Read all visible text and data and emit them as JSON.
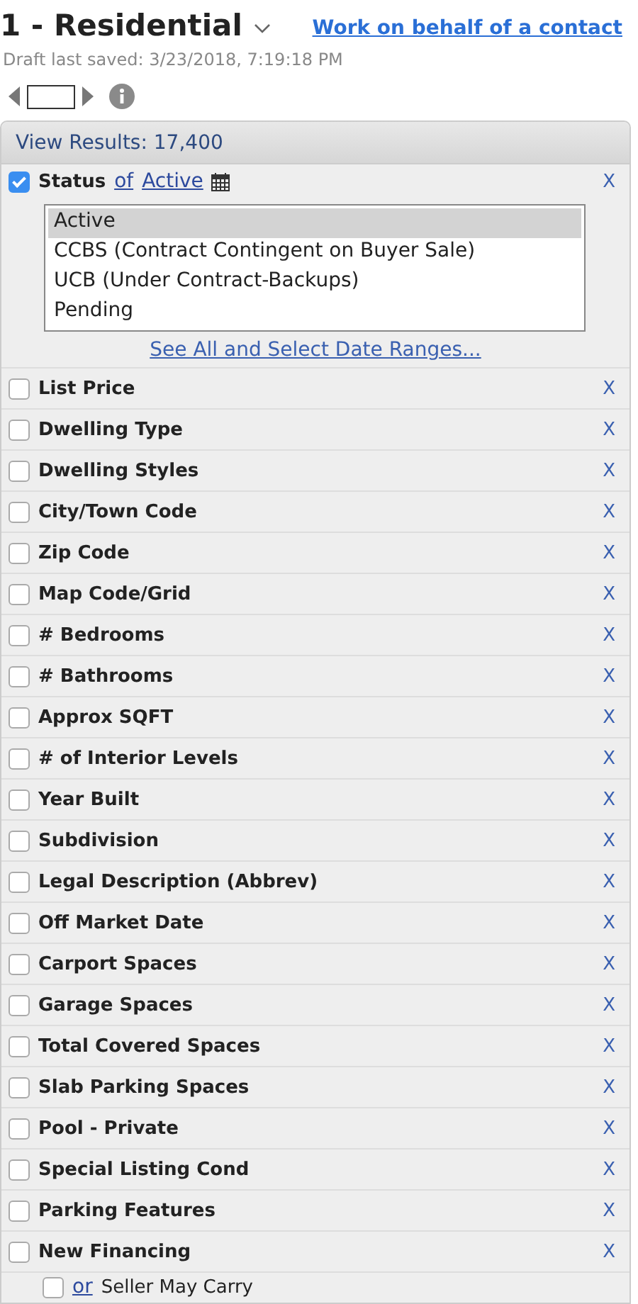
{
  "header": {
    "title": "1 - Residential",
    "link": "Work on behalf of a contact",
    "draft": "Draft last saved: 3/23/2018, 7:19:18 PM"
  },
  "panel": {
    "results": "View Results: 17,400"
  },
  "status": {
    "checked": true,
    "label": "Status",
    "connector": "of",
    "value": "Active",
    "remove": "X",
    "options": [
      {
        "label": "Active",
        "selected": true
      },
      {
        "label": "CCBS (Contract Contingent on Buyer Sale)",
        "selected": false
      },
      {
        "label": "UCB (Under Contract-Backups)",
        "selected": false
      },
      {
        "label": "Pending",
        "selected": false
      }
    ],
    "more_link": "See All and Select Date Ranges..."
  },
  "filters": [
    {
      "label": "List Price",
      "checked": false,
      "remove": "X"
    },
    {
      "label": "Dwelling Type",
      "checked": false,
      "remove": "X"
    },
    {
      "label": "Dwelling Styles",
      "checked": false,
      "remove": "X"
    },
    {
      "label": "City/Town Code",
      "checked": false,
      "remove": "X"
    },
    {
      "label": "Zip Code",
      "checked": false,
      "remove": "X"
    },
    {
      "label": "Map Code/Grid",
      "checked": false,
      "remove": "X"
    },
    {
      "label": "# Bedrooms",
      "checked": false,
      "remove": "X"
    },
    {
      "label": "# Bathrooms",
      "checked": false,
      "remove": "X"
    },
    {
      "label": "Approx SQFT",
      "checked": false,
      "remove": "X"
    },
    {
      "label": "# of Interior Levels",
      "checked": false,
      "remove": "X"
    },
    {
      "label": "Year Built",
      "checked": false,
      "remove": "X"
    },
    {
      "label": "Subdivision",
      "checked": false,
      "remove": "X"
    },
    {
      "label": "Legal Description (Abbrev)",
      "checked": false,
      "remove": "X"
    },
    {
      "label": "Off Market Date",
      "checked": false,
      "remove": "X"
    },
    {
      "label": "Carport Spaces",
      "checked": false,
      "remove": "X"
    },
    {
      "label": "Garage Spaces",
      "checked": false,
      "remove": "X"
    },
    {
      "label": "Total Covered Spaces",
      "checked": false,
      "remove": "X"
    },
    {
      "label": "Slab Parking Spaces",
      "checked": false,
      "remove": "X"
    },
    {
      "label": "Pool - Private",
      "checked": false,
      "remove": "X"
    },
    {
      "label": "Special Listing Cond",
      "checked": false,
      "remove": "X"
    },
    {
      "label": "Parking Features",
      "checked": false,
      "remove": "X"
    },
    {
      "label": "New Financing",
      "checked": false,
      "remove": "X",
      "sub_options": [
        {
          "connector": "or",
          "label": "Seller May Carry",
          "checked": false
        }
      ]
    }
  ]
}
